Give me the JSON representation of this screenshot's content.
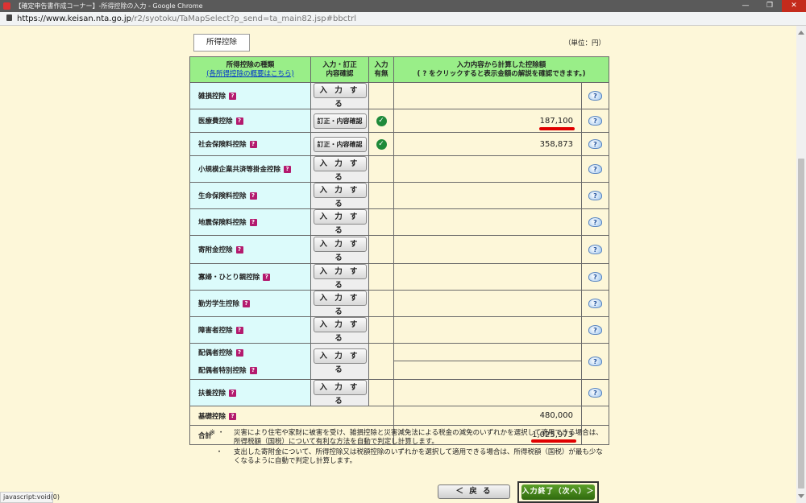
{
  "window": {
    "title": "【確定申告書作成コーナー】-所得控除の入力 - Google Chrome",
    "minimize": "—",
    "maximize": "❐",
    "close": "✕"
  },
  "address": {
    "host": "https://www.keisan.nta.go.jp",
    "path": "/r2/syotoku/TaMapSelect?p_send=ta_main82.jsp#bbctrl"
  },
  "page": {
    "tab_label": "所得控除",
    "unit": "（単位：円）"
  },
  "table": {
    "header": {
      "col1_title": "所得控除の種類",
      "col1_link": "(各所得控除の概要はこちら)",
      "col2": "入力・訂正\n内容確認",
      "col3": "入力\n有無",
      "col4_line1": "入力内容から計算した控除額",
      "col4_line2": "( ? をクリックすると表示金額の解説を確認できます。)"
    },
    "rows": [
      {
        "name": "雑損控除",
        "button": "入 力 す る",
        "amount": ""
      },
      {
        "name": "医療費控除",
        "button": "訂正・内容確認",
        "amount": "187,100"
      },
      {
        "name": "社会保険料控除",
        "button": "訂正・内容確認",
        "amount": "358,873"
      },
      {
        "name": "小規模企業共済等掛金控除",
        "button": "入 力 す る",
        "amount": ""
      },
      {
        "name": "生命保険料控除",
        "button": "入 力 す る",
        "amount": ""
      },
      {
        "name": "地震保険料控除",
        "button": "入 力 す る",
        "amount": ""
      },
      {
        "name": "寄附金控除",
        "button": "入 力 す る",
        "amount": ""
      },
      {
        "name": "寡婦・ひとり親控除",
        "button": "入 力 す る",
        "amount": ""
      },
      {
        "name": "勤労学生控除",
        "button": "入 力 す る",
        "amount": ""
      },
      {
        "name": "障害者控除",
        "button": "入 力 す る",
        "amount": ""
      },
      {
        "name": "配偶者控除",
        "button": "入 力 す る",
        "amount": ""
      },
      {
        "name": "配偶者特別控除",
        "button": "",
        "amount": ""
      },
      {
        "name": "扶養控除",
        "button": "入 力 す る",
        "amount": ""
      }
    ],
    "basic_label": "基礎控除",
    "basic_amount": "480,000",
    "total_label": "合計",
    "total_amount": "1,025,973"
  },
  "icons": {
    "question_mark": "?",
    "check": "✓",
    "help": "?"
  },
  "notes": {
    "mark1": "※ ・",
    "text1": "災害により住宅や家財に被害を受け、雑損控除と災害減免法による税金の減免のいずれかを選択して適用できる場合は、所得税額（国税）について有利な方法を自動で判定し計算します。",
    "mark2": "・",
    "text2": "支出した寄附金について、所得控除又は税額控除のいずれかを選択して適用できる場合は、所得税額（国税）が最も少なくなるように自動で判定し計算します。"
  },
  "footer": {
    "back_label": "＜ 戻 る",
    "next_label": "入力終了（次へ）＞"
  },
  "statusbar": "javascript:void(0)",
  "colors": {
    "header_bg": "#99ee88",
    "name_bg": "#dcfbfb",
    "highlight_underline": "#e00000",
    "next_button": "#3d7e18"
  }
}
